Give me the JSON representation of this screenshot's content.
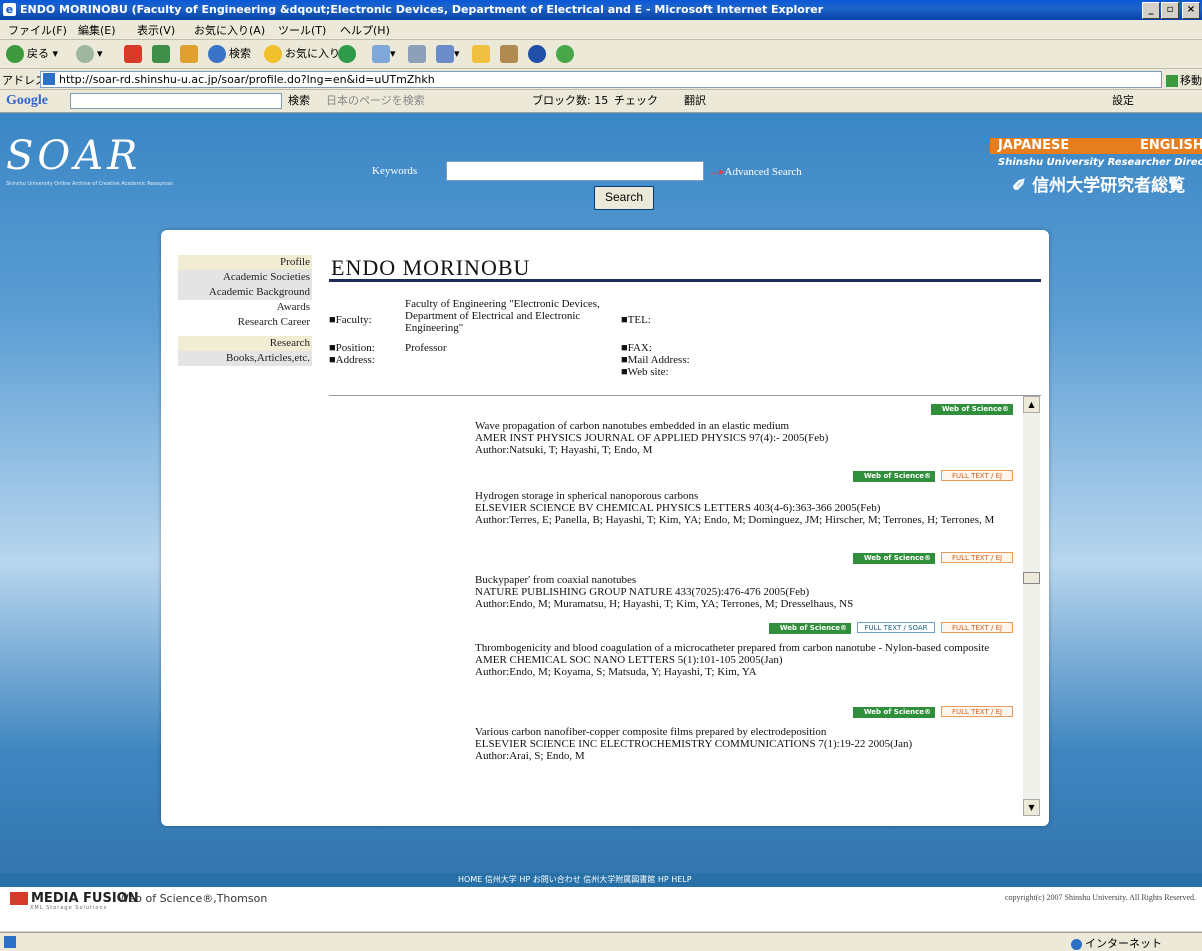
{
  "window": {
    "title": "ENDO  MORINOBU (Faculty of Engineering &dqout;Electronic Devices, Department of Electrical and E - Microsoft Internet Explorer",
    "min": "_",
    "max": "▫",
    "close": "×"
  },
  "menu": [
    "ファイル(F)",
    "編集(E)",
    "表示(V)",
    "お気に入り(A)",
    "ツール(T)",
    "ヘルプ(H)"
  ],
  "toolbar": {
    "back": "戻る",
    "search": "検索",
    "favorites": "お気に入り"
  },
  "address": {
    "label": "アドレス(D)",
    "url": "http://soar-rd.shinshu-u.ac.jp/soar/profile.do?lng=en&id=uUTmZhkh",
    "go": "移動"
  },
  "google_bar": {
    "logo": "Google",
    "search": "検索",
    "japanese_pages": "日本のページを検索",
    "popup_blocked": "ブロック数: 15",
    "check": "チェック",
    "translate": "翻訳",
    "settings": "設定"
  },
  "site": {
    "logo": "SOAR",
    "logo_sub": "Shinshu University Online Archive of Creative Academic Resources",
    "keywords_label": "Keywords",
    "keywords_value": "",
    "advanced_search": "Advanced Search",
    "search_button": "Search",
    "lang_japanese": "JAPANESE",
    "lang_english": "ENGLISH",
    "directory_en": "Shinshu University Researcher Directory",
    "directory_jp": "信州大学研究者総覧"
  },
  "nav": [
    {
      "label": "Profile",
      "style": "hl"
    },
    {
      "label": "Academic Societies",
      "style": "gy"
    },
    {
      "label": "Academic Background",
      "style": "gy"
    },
    {
      "label": "Awards",
      "style": "plain"
    },
    {
      "label": "Research Career",
      "style": "plain"
    },
    {
      "label": "Research",
      "style": "hl"
    },
    {
      "label": "Books,Articles,etc.",
      "style": "gy"
    }
  ],
  "profile": {
    "name": "ENDO  MORINOBU",
    "faculty_label": "■Faculty:",
    "faculty_value": "Faculty of Engineering \"Electronic Devices, Department of Electrical and Electronic Engineering\"",
    "position_label": "■Position:",
    "position_value": "Professor",
    "address_label": "■Address:",
    "tel_label": "■TEL:",
    "fax_label": "■FAX:",
    "mail_label": "■Mail Address:",
    "web_label": "■Web site:"
  },
  "badges": {
    "wos": "Web of Science®",
    "fulltext_ej": "FULL TEXT / EJ",
    "fulltext_soar": "FULL TEXT / SOAR"
  },
  "publications": [
    {
      "title": "Wave propagation of carbon nanotubes embedded in an elastic medium",
      "source": "AMER INST PHYSICS JOURNAL OF APPLIED PHYSICS 97(4):- 2005(Feb)",
      "authors": "Author:Natsuki, T; Hayashi, T; Endo, M"
    },
    {
      "title": "Hydrogen storage in spherical nanoporous carbons",
      "source": "ELSEVIER SCIENCE BV CHEMICAL PHYSICS LETTERS 403(4-6):363-366 2005(Feb)",
      "authors": "Author:Terres, E; Panella, B; Hayashi, T; Kim, YA; Endo, M; Dominguez, JM; Hirscher, M; Terrones, H; Terrones, M"
    },
    {
      "title": "Buckypaper' from coaxial nanotubes",
      "source": "NATURE PUBLISHING GROUP NATURE 433(7025):476-476 2005(Feb)",
      "authors": "Author:Endo, M; Muramatsu, H; Hayashi, T; Kim, YA; Terrones, M; Dresselhaus, NS"
    },
    {
      "title": "Thrombogenicity and blood coagulation of a microcatheter prepared from carbon nanotube - Nylon-based composite",
      "source": "AMER CHEMICAL SOC NANO LETTERS 5(1):101-105 2005(Jan)",
      "authors": "Author:Endo, M; Koyama, S; Matsuda, Y; Hayashi, T; Kim, YA"
    },
    {
      "title": "Various carbon nanofiber-copper composite films prepared by electrodeposition",
      "source": "ELSEVIER SCIENCE INC ELECTROCHEMISTRY COMMUNICATIONS 7(1):19-22 2005(Jan)",
      "authors": "Author:Arai, S; Endo, M"
    }
  ],
  "footer": {
    "links": "HOME  信州大学 HP  お問い合わせ  信州大学附属図書館 HP  HELP",
    "media_fusion": "MEDIA FUSION",
    "media_fusion_sub": "XML Storage Solutions",
    "wos_credit": "Web of Science®,Thomson",
    "copyright": "copyright(c) 2007 Shinshu University. All Rights Reserved."
  },
  "status": {
    "zone": "インターネット"
  }
}
